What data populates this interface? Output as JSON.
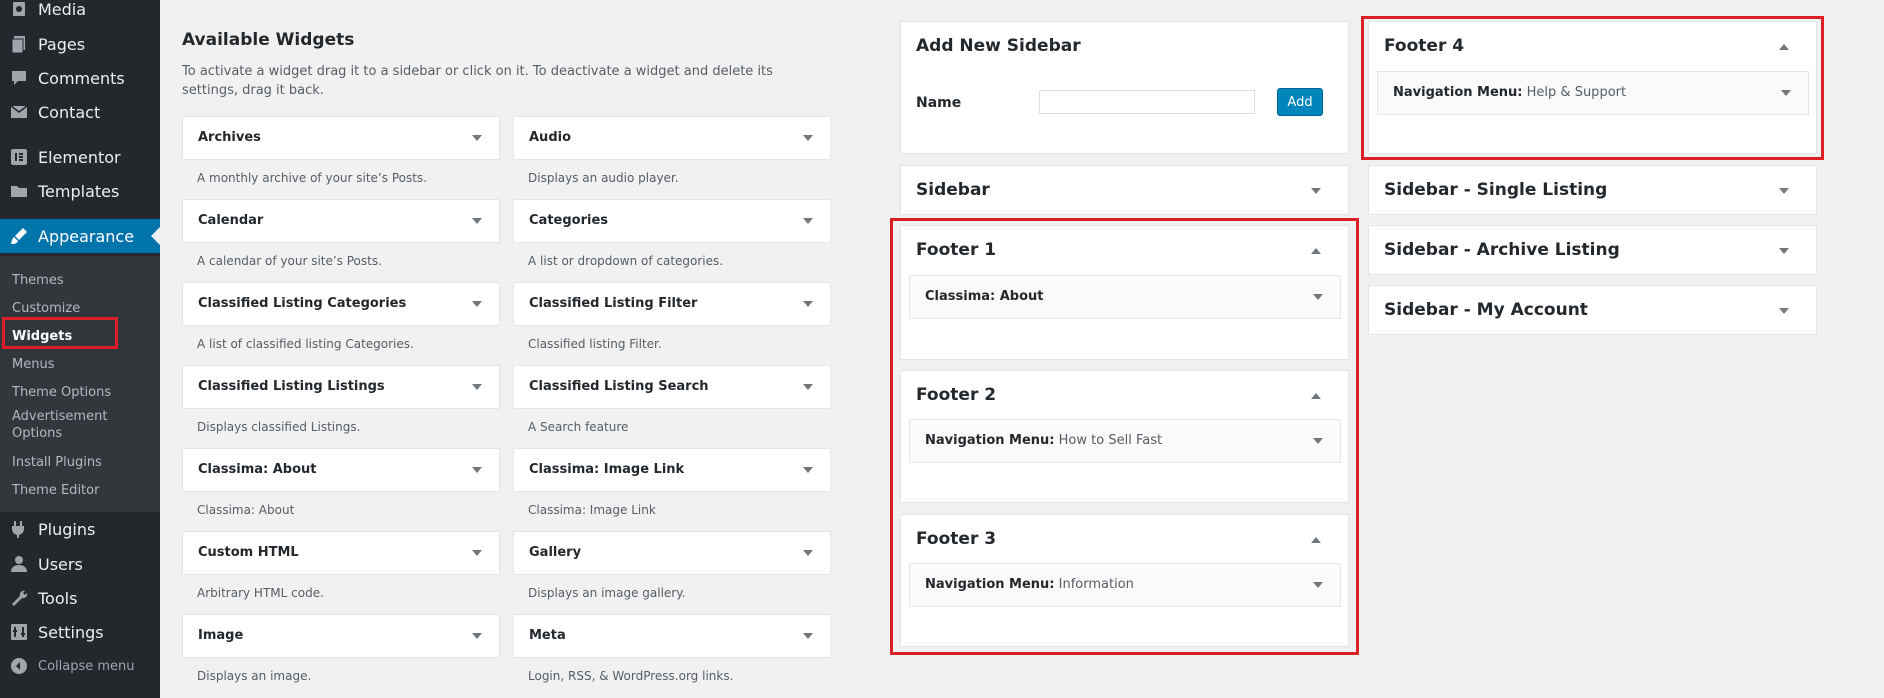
{
  "admin_menu": {
    "items": [
      {
        "label": "Media",
        "icon": "media-icon"
      },
      {
        "label": "Pages",
        "icon": "pages-icon"
      },
      {
        "label": "Comments",
        "icon": "comments-icon"
      },
      {
        "label": "Contact",
        "icon": "envelope-icon"
      },
      {
        "label": "Elementor",
        "icon": "elementor-icon"
      },
      {
        "label": "Templates",
        "icon": "folder-icon"
      },
      {
        "label": "Appearance",
        "icon": "paintbrush-icon"
      },
      {
        "label": "Plugins",
        "icon": "plugin-icon"
      },
      {
        "label": "Users",
        "icon": "users-icon"
      },
      {
        "label": "Tools",
        "icon": "wrench-icon"
      },
      {
        "label": "Settings",
        "icon": "settings-icon"
      }
    ],
    "appearance_submenu": [
      "Themes",
      "Customize",
      "Widgets",
      "Menus",
      "Theme Options",
      "Advertisement Options",
      "Install Plugins",
      "Theme Editor"
    ],
    "collapse_label": "Collapse menu",
    "highlight_color": "#dd1f26",
    "accent_color": "#0073aa"
  },
  "available_widgets": {
    "title": "Available Widgets",
    "description": "To activate a widget drag it to a sidebar or click on it. To deactivate a widget and delete its settings, drag it back.",
    "widgets": [
      {
        "name": "Archives",
        "desc": "A monthly archive of your site’s Posts."
      },
      {
        "name": "Audio",
        "desc": "Displays an audio player."
      },
      {
        "name": "Calendar",
        "desc": "A calendar of your site’s Posts."
      },
      {
        "name": "Categories",
        "desc": "A list or dropdown of categories."
      },
      {
        "name": "Classified Listing Categories",
        "desc": "A list of classified listing Categories."
      },
      {
        "name": "Classified Listing Filter",
        "desc": "Classified listing Filter."
      },
      {
        "name": "Classified Listing Listings",
        "desc": "Displays classified Listings."
      },
      {
        "name": "Classified Listing Search",
        "desc": "A Search feature"
      },
      {
        "name": "Classima: About",
        "desc": "Classima: About"
      },
      {
        "name": "Classima: Image Link",
        "desc": "Classima: Image Link"
      },
      {
        "name": "Custom HTML",
        "desc": "Arbitrary HTML code."
      },
      {
        "name": "Gallery",
        "desc": "Displays an image gallery."
      },
      {
        "name": "Image",
        "desc": "Displays an image."
      },
      {
        "name": "Meta",
        "desc": "Login, RSS, & WordPress.org links."
      }
    ]
  },
  "add_sidebar": {
    "title": "Add New Sidebar",
    "name_label": "Name",
    "input_value": "",
    "button_label": "Add"
  },
  "sidebars": {
    "sidebar": {
      "title": "Sidebar"
    },
    "footer1": {
      "title": "Footer 1",
      "widget_type": "Classima: About",
      "widget_title": ""
    },
    "footer2": {
      "title": "Footer 2",
      "widget_type": "Navigation Menu:",
      "widget_title": "How to Sell Fast"
    },
    "footer3": {
      "title": "Footer 3",
      "widget_type": "Navigation Menu:",
      "widget_title": "Information"
    },
    "footer4": {
      "title": "Footer 4",
      "widget_type": "Navigation Menu:",
      "widget_title": "Help & Support"
    },
    "single_listing": {
      "title": "Sidebar - Single Listing"
    },
    "archive_listing": {
      "title": "Sidebar - Archive Listing"
    },
    "my_account": {
      "title": "Sidebar - My Account"
    }
  }
}
